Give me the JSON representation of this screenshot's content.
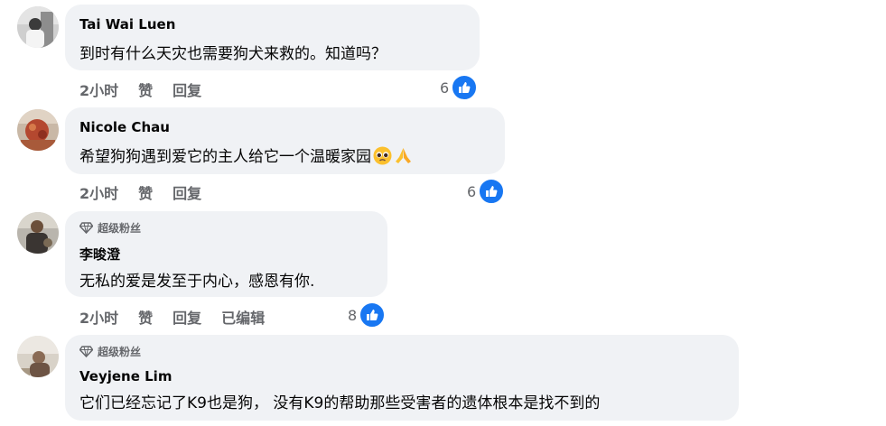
{
  "comments": [
    {
      "author": "Tai Wai Luen",
      "text": "到时有什么天灾也需要狗犬来救的。知道吗？",
      "time": "2小时",
      "like_action": "赞",
      "reply_action": "回复",
      "reaction_count": "6",
      "reaction_icon": "thumbs-up-icon"
    },
    {
      "author": "Nicole Chau",
      "text": "希望狗狗遇到爱它的主人给它一个温暖家园",
      "emojis": [
        "pleading-face-emoji",
        "folded-hands-emoji"
      ],
      "time": "2小时",
      "like_action": "赞",
      "reply_action": "回复",
      "reaction_count": "6",
      "reaction_icon": "thumbs-up-icon"
    },
    {
      "badge": "超级粉丝",
      "badge_icon": "diamond-icon",
      "author": "李晙澄",
      "text": "无私的爱是发至于内心，感恩有你.",
      "time": "2小时",
      "like_action": "赞",
      "reply_action": "回复",
      "edited_label": "已编辑",
      "reaction_count": "8",
      "reaction_icon": "thumbs-up-icon"
    },
    {
      "badge": "超级粉丝",
      "badge_icon": "diamond-icon",
      "author": "Veyjene Lim",
      "text": "它们已经忘记了K9也是狗， 没有K9的帮助那些受害者的遗体根本是找不到的"
    }
  ],
  "colors": {
    "bubble": "#f0f2f5",
    "secondary_text": "#65676b",
    "primary_text": "#050505",
    "like_blue": "#1877f2"
  }
}
